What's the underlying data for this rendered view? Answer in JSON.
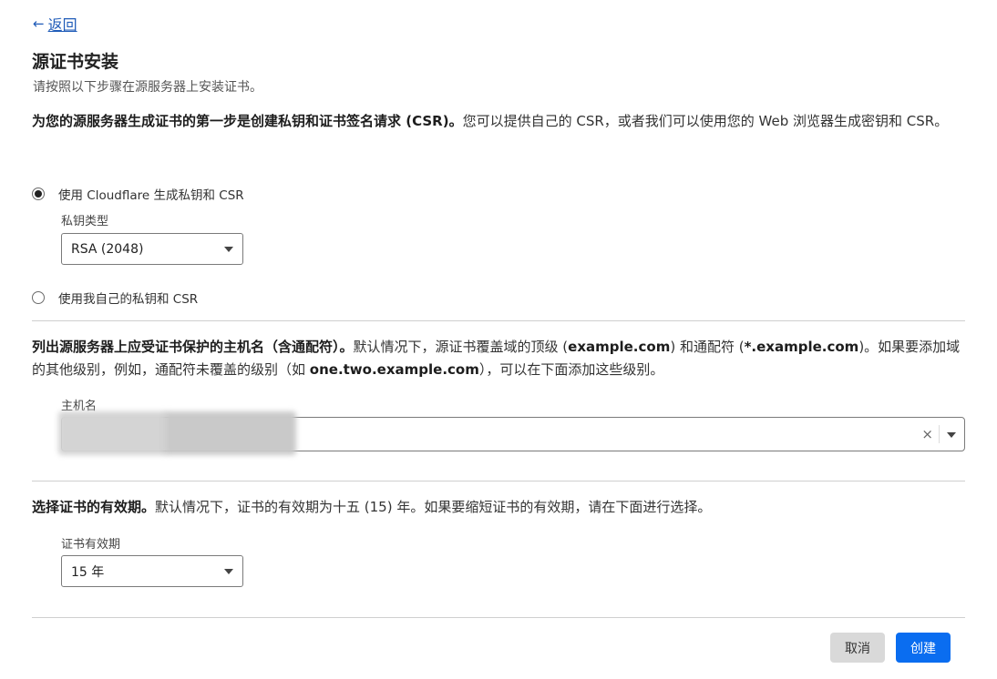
{
  "back": {
    "label": "返回"
  },
  "header": {
    "title": "源证书安装",
    "subtitle": "请按照以下步骤在源服务器上安装证书。"
  },
  "section_key": {
    "intro_bold": "为您的源服务器生成证书的第一步是创建私钥和证书签名请求 (CSR)。",
    "intro_rest": "您可以提供自己的 CSR，或者我们可以使用您的 Web 浏览器生成密钥和 CSR。",
    "option_cloudflare": "使用 Cloudflare 生成私钥和 CSR",
    "key_type_label": "私钥类型",
    "key_type_value": "RSA (2048)",
    "option_own": "使用我自己的私钥和 CSR"
  },
  "section_hosts": {
    "p1_bold": "列出源服务器上应受证书保护的主机名（含通配符）。",
    "p2": "默认情况下，源证书覆盖域的顶级 (",
    "p3_bold": "example.com",
    "p4": ") 和通配符 (",
    "p5_bold": "*.example.com",
    "p6": ")。如果要添加域的其他级别，例如，通配符未覆盖的级别（如 ",
    "p7_bold": "one.two.example.com",
    "p8": "），可以在下面添加这些级别。",
    "hostname_label": "主机名",
    "clear_glyph": "×"
  },
  "section_validity": {
    "intro_bold": "选择证书的有效期。",
    "intro_rest": "默认情况下，证书的有效期为十五 (15) 年。如果要缩短证书的有效期，请在下面进行选择。",
    "validity_label": "证书有效期",
    "validity_value": "15 年"
  },
  "footer": {
    "cancel_label": "取消",
    "create_label": "创建"
  },
  "colors": {
    "link": "#1f5bb8",
    "primary_button": "#0a6df0",
    "secondary_button": "#d9d9d9"
  },
  "icons": {
    "back": "arrow-left-icon",
    "select": "caret-down-icon",
    "clear": "close-icon"
  }
}
